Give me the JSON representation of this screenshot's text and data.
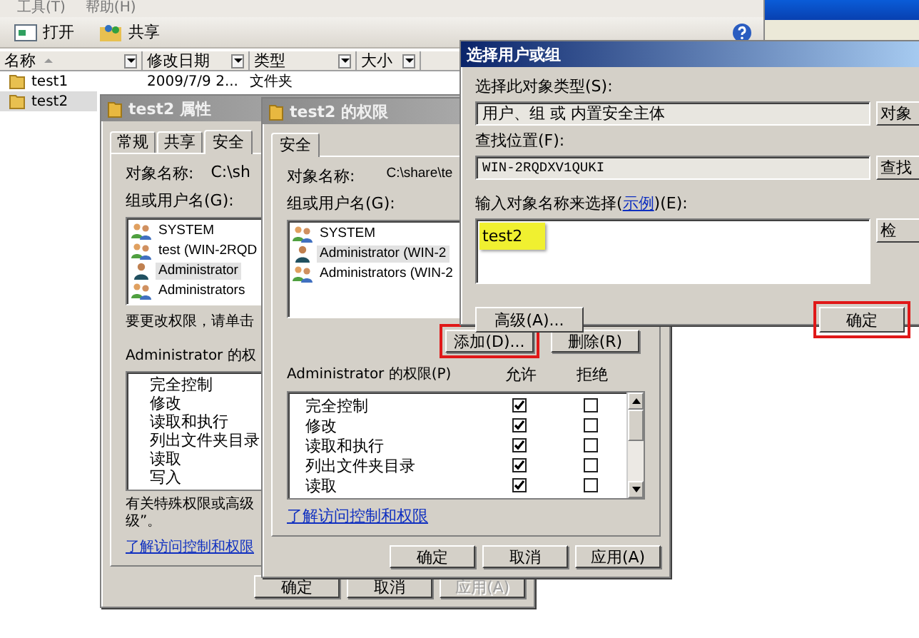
{
  "explorer": {
    "menu": [
      "工具(T)",
      "帮助(H)"
    ],
    "toolbar": [
      {
        "label": "打开"
      },
      {
        "label": "共享"
      }
    ],
    "columns": [
      "名称",
      "修改日期",
      "类型",
      "大小"
    ],
    "rows": [
      {
        "name": "test1",
        "modified": "2009/7/9 2...",
        "type": "文件夹",
        "selected": false
      },
      {
        "name": "test2",
        "selected": true
      }
    ]
  },
  "properties": {
    "title": "test2 属性",
    "active": false,
    "tabs": [
      {
        "label": "常规",
        "selected": false
      },
      {
        "label": "共享",
        "selected": false
      },
      {
        "label": "安全",
        "selected": true
      }
    ],
    "object_label": "对象名称:",
    "object_value": "C:\\sh",
    "group_label": "组或用户名(G):",
    "principals": [
      {
        "name": "SYSTEM",
        "kind": "group",
        "selected": false
      },
      {
        "name": "test (WIN-2RQD",
        "kind": "group",
        "selected": false
      },
      {
        "name": "Administrator",
        "kind": "user",
        "selected": true
      },
      {
        "name": "Administrators",
        "kind": "group",
        "selected": false
      }
    ],
    "hint": "要更改权限，请单击",
    "perm_label": "Administrator 的权",
    "permissions": [
      "完全控制",
      "修改",
      "读取和执行",
      "列出文件夹目录",
      "读取",
      "写入"
    ],
    "note_lines": [
      "有关特殊权限或高级",
      "级”。"
    ],
    "link": "了解访问控制和权限",
    "buttons": [
      {
        "label": "确定",
        "disabled": false
      },
      {
        "label": "取消",
        "disabled": false
      },
      {
        "label": "应用(A)",
        "disabled": true
      }
    ]
  },
  "permissions_dialog": {
    "title": "test2 的权限",
    "active": false,
    "tabs": [
      {
        "label": "安全",
        "selected": true
      }
    ],
    "object_label": "对象名称:",
    "object_value": "C:\\share\\te",
    "group_label": "组或用户名(G):",
    "principals": [
      {
        "name": "SYSTEM",
        "kind": "group",
        "selected": false
      },
      {
        "name": "Administrator (WIN-2",
        "kind": "user",
        "selected": true
      },
      {
        "name": "Administrators (WIN-2",
        "kind": "group",
        "selected": false
      }
    ],
    "actions": [
      {
        "label": "添加(D)...",
        "highlighted": true
      },
      {
        "label": "删除(R)",
        "highlighted": false
      }
    ],
    "perm_label": "Administrator 的权限(P)",
    "allow_label": "允许",
    "deny_label": "拒绝",
    "permissions": [
      {
        "name": "完全控制",
        "allow": true,
        "deny": false
      },
      {
        "name": "修改",
        "allow": true,
        "deny": false
      },
      {
        "name": "读取和执行",
        "allow": true,
        "deny": false
      },
      {
        "name": "列出文件夹目录",
        "allow": true,
        "deny": false
      },
      {
        "name": "读取",
        "allow": true,
        "deny": false
      }
    ],
    "link": "了解访问控制和权限",
    "buttons": [
      {
        "label": "确定",
        "disabled": false
      },
      {
        "label": "取消",
        "disabled": false
      },
      {
        "label": "应用(A)",
        "disabled": false
      }
    ]
  },
  "select_dialog": {
    "title": "选择用户或组",
    "active": true,
    "type_label": "选择此对象类型(S):",
    "type_value": "用户、组 或 内置安全主体",
    "type_button": "对象",
    "location_label": "查找位置(F):",
    "location_value": "WIN-2RQDXV1QUKI",
    "location_button": "查找",
    "name_label_before": "输入对象名称来选择(",
    "example_link": "示例",
    "name_label_after": ")(E):",
    "name_value": "test2",
    "name_highlighted": true,
    "check_button": "检",
    "advanced_button": "高级(A)...",
    "ok_button": {
      "label": "确定",
      "highlighted": true
    }
  }
}
